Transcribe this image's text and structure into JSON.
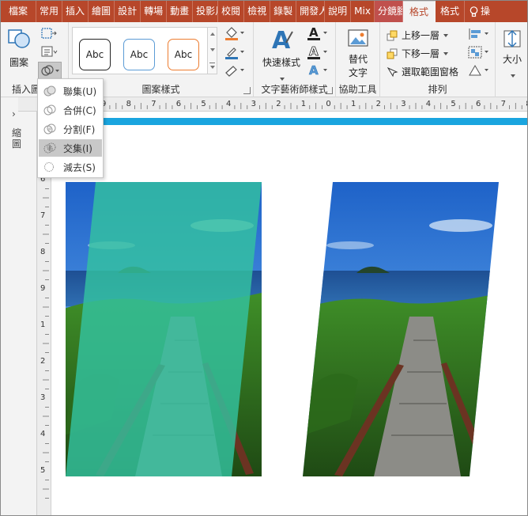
{
  "tabs": [
    {
      "label": "檔案"
    },
    {
      "label": "常用"
    },
    {
      "label": "插入"
    },
    {
      "label": "繪圖"
    },
    {
      "label": "設計"
    },
    {
      "label": "轉場"
    },
    {
      "label": "動畫"
    },
    {
      "label": "投影片"
    },
    {
      "label": "校閱"
    },
    {
      "label": "檢視"
    },
    {
      "label": "錄製"
    },
    {
      "label": "開發人員"
    },
    {
      "label": "說明"
    },
    {
      "label": "Mix"
    },
    {
      "label": "分鏡腳本"
    },
    {
      "label": "格式"
    },
    {
      "label": "格式"
    }
  ],
  "tell_me": "操",
  "ribbon": {
    "insert_shape": {
      "shapes_label": "圖案",
      "group_label": "插入圖"
    },
    "shape_styles": {
      "style1": "Abc",
      "style2": "Abc",
      "style3": "Abc",
      "group_label": "圖案樣式"
    },
    "wordart": {
      "quick_styles_label": "快速樣式",
      "group_label": "文字藝術師樣式"
    },
    "accessibility": {
      "alt_text_line1": "替代",
      "alt_text_line2": "文字",
      "group_label": "協助工具"
    },
    "arrange": {
      "bring_forward": "上移一層",
      "send_backward": "下移一層",
      "selection_pane": "選取範圍窗格",
      "group_label": "排列"
    },
    "size": {
      "label": "大小"
    }
  },
  "left_pane": {
    "label": "縮圖"
  },
  "merge_menu": {
    "items": [
      {
        "label": "聯集(U)"
      },
      {
        "label": "合併(C)"
      },
      {
        "label": "分割(F)"
      },
      {
        "label": "交集(I)"
      },
      {
        "label": "減去(S)"
      }
    ],
    "highlighted_index": 3
  },
  "ruler": {
    "h_numbers": [
      "9",
      "8",
      "7",
      "6",
      "5",
      "4",
      "3",
      "2",
      "1",
      "0",
      "1",
      "2",
      "3",
      "4",
      "5",
      "6",
      "7",
      "8",
      "9",
      "10"
    ],
    "v_numbers": [
      "5",
      "6",
      "7",
      "8",
      "9",
      "1",
      "2",
      "3",
      "4",
      "5"
    ]
  },
  "colors": {
    "tab_bar": "#b7472a",
    "ribbon": "#f3f3f3",
    "slide_accent": "#1aa5df",
    "overlay_teal": "#33c2a0"
  }
}
